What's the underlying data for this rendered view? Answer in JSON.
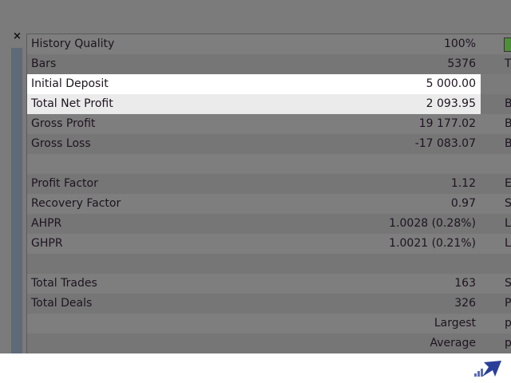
{
  "rows": [
    {
      "label": "History Quality",
      "value": "100%",
      "ext": "",
      "green": true
    },
    {
      "label": "Bars",
      "value": "5376",
      "ext": "T"
    },
    {
      "label": "Initial Deposit",
      "value": "5 000.00",
      "ext": "",
      "hl": 1
    },
    {
      "label": "Total Net Profit",
      "value": "2 093.95",
      "ext": "B",
      "hl": 2
    },
    {
      "label": "Gross Profit",
      "value": "19 177.02",
      "ext": "B"
    },
    {
      "label": "Gross Loss",
      "value": "-17 083.07",
      "ext": "B"
    },
    {
      "label": "",
      "value": "",
      "ext": ""
    },
    {
      "label": "Profit Factor",
      "value": "1.12",
      "ext": "E"
    },
    {
      "label": "Recovery Factor",
      "value": "0.97",
      "ext": "S"
    },
    {
      "label": "AHPR",
      "value": "1.0028 (0.28%)",
      "ext": "L"
    },
    {
      "label": "GHPR",
      "value": "1.0021 (0.21%)",
      "ext": "L"
    },
    {
      "label": "",
      "value": "",
      "ext": ""
    },
    {
      "label": "Total Trades",
      "value": "163",
      "ext": "S"
    },
    {
      "label": "Total Deals",
      "value": "326",
      "ext": "P"
    },
    {
      "label": "",
      "value": "Largest",
      "ext": "p"
    },
    {
      "label": "",
      "value": "Average",
      "ext": "p"
    }
  ],
  "close_label": "×",
  "colors": {
    "quality": "#4f8f3a",
    "logo": "#2a3f9a"
  }
}
